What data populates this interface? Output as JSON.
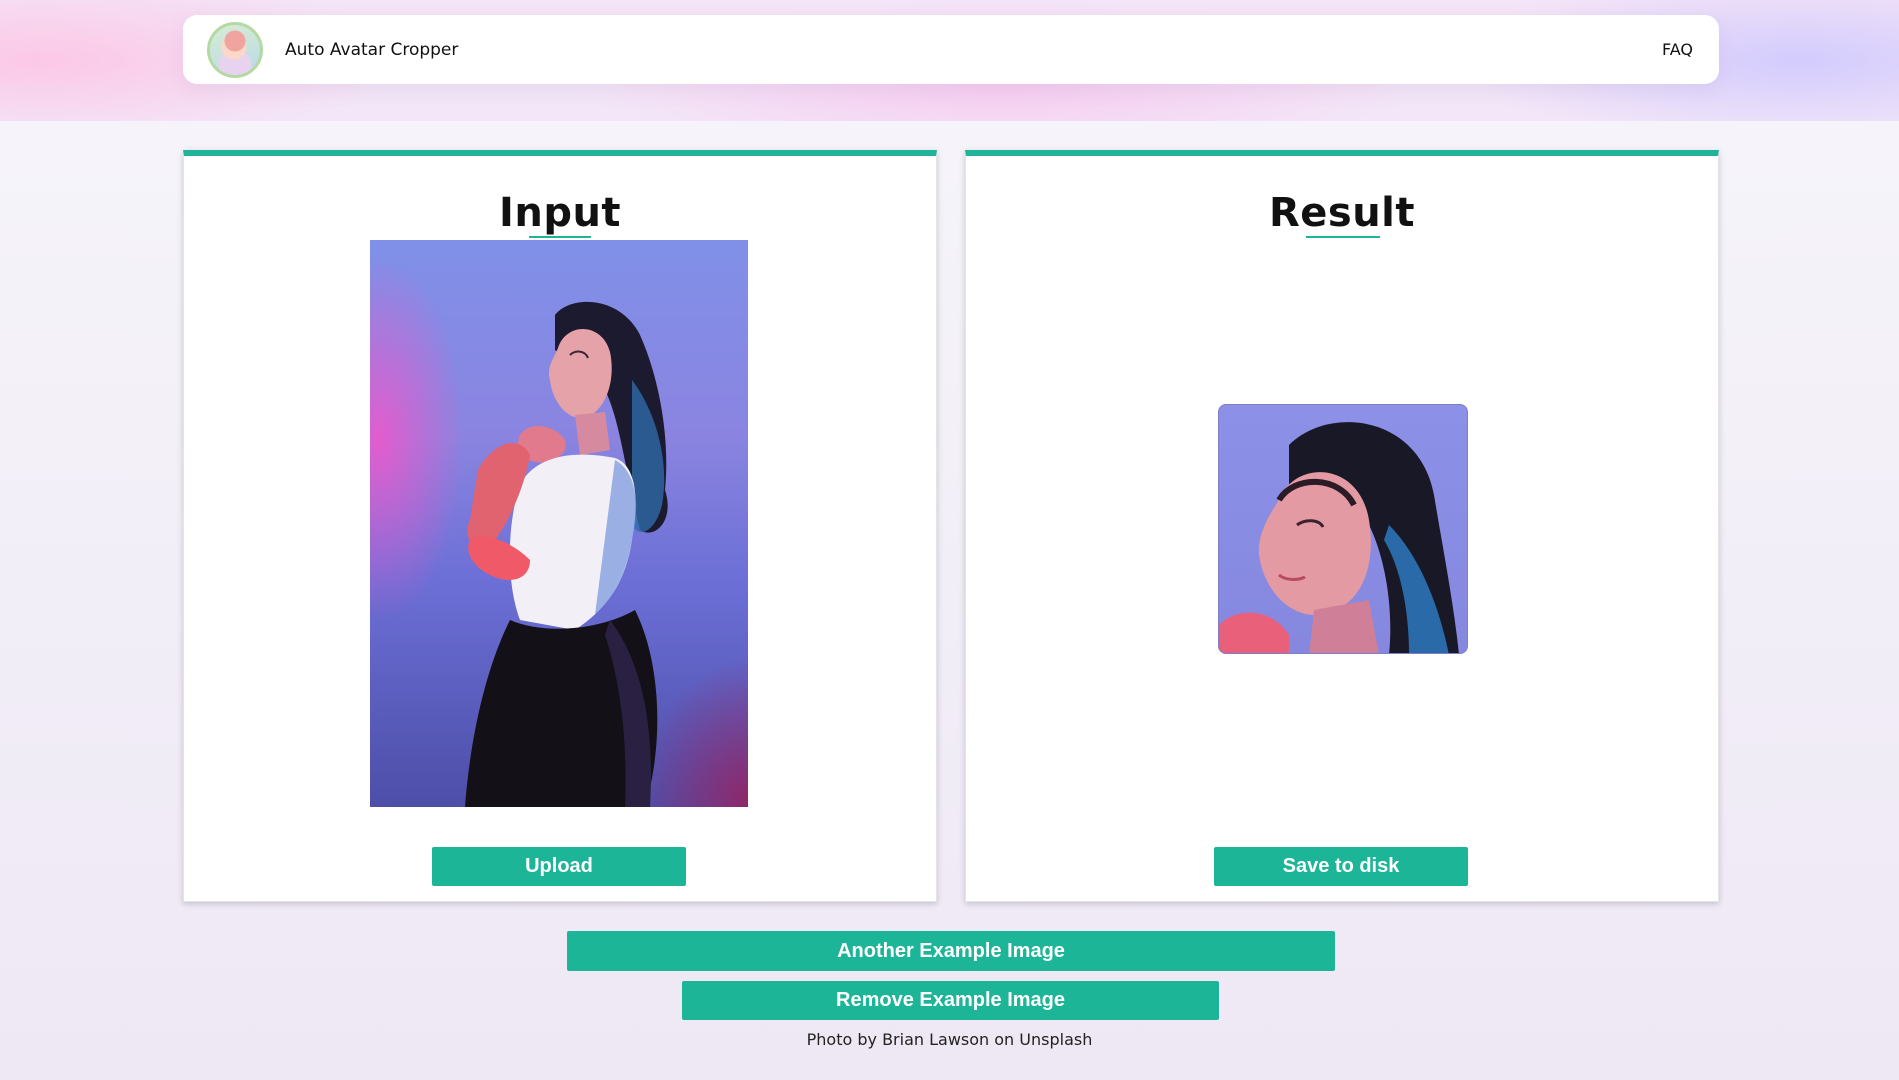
{
  "header": {
    "logo_icon": "avatar-logo-icon",
    "app_name": "Auto Avatar Cropper",
    "faq_link": "FAQ"
  },
  "input_panel": {
    "title": "Input",
    "upload_button": "Upload"
  },
  "result_panel": {
    "title": "Result",
    "save_button": "Save to disk"
  },
  "actions": {
    "another_example": "Another Example Image",
    "remove_example": "Remove Example Image"
  },
  "credit": "Photo by Brian Lawson on Unsplash",
  "colors": {
    "accent": "#1db598",
    "panel_border_top": "#1fb39a"
  }
}
